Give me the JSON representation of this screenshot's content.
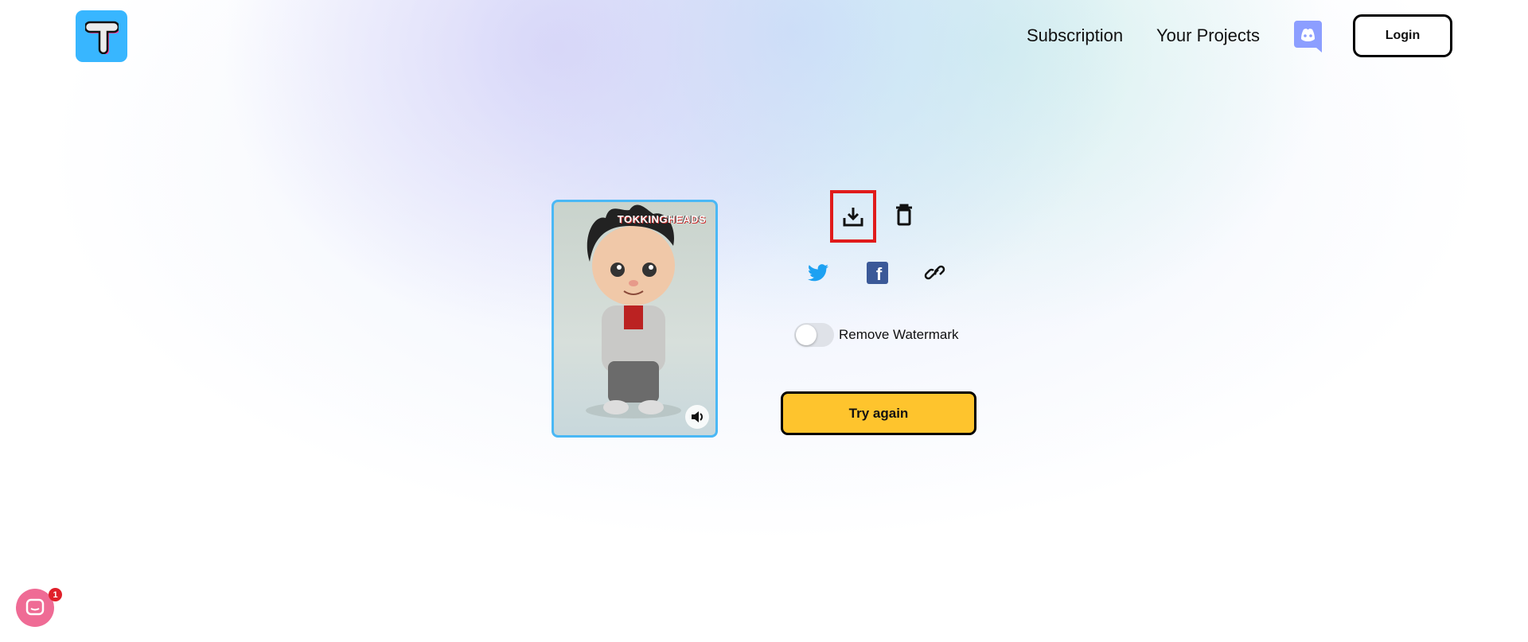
{
  "header": {
    "logo_letter": "T",
    "nav": [
      {
        "label": "Subscription"
      },
      {
        "label": "Your Projects"
      }
    ],
    "discord_icon": "discord-icon",
    "login_label": "Login"
  },
  "preview": {
    "watermark": "TOKKINGHEADS",
    "sound_icon": "speaker-icon"
  },
  "actions": {
    "download_icon": "download-icon",
    "delete_icon": "trash-icon",
    "share": [
      "twitter-icon",
      "facebook-icon",
      "link-icon"
    ],
    "remove_watermark_label": "Remove Watermark",
    "remove_watermark_on": false,
    "try_again_label": "Try again"
  },
  "chat": {
    "badge_count": "1"
  },
  "colors": {
    "accent": "#38b6ff",
    "button": "#fec42d",
    "highlight": "#e01b1b",
    "twitter": "#1da1f2",
    "facebook": "#3b5998",
    "discord": "#8c9eff"
  }
}
